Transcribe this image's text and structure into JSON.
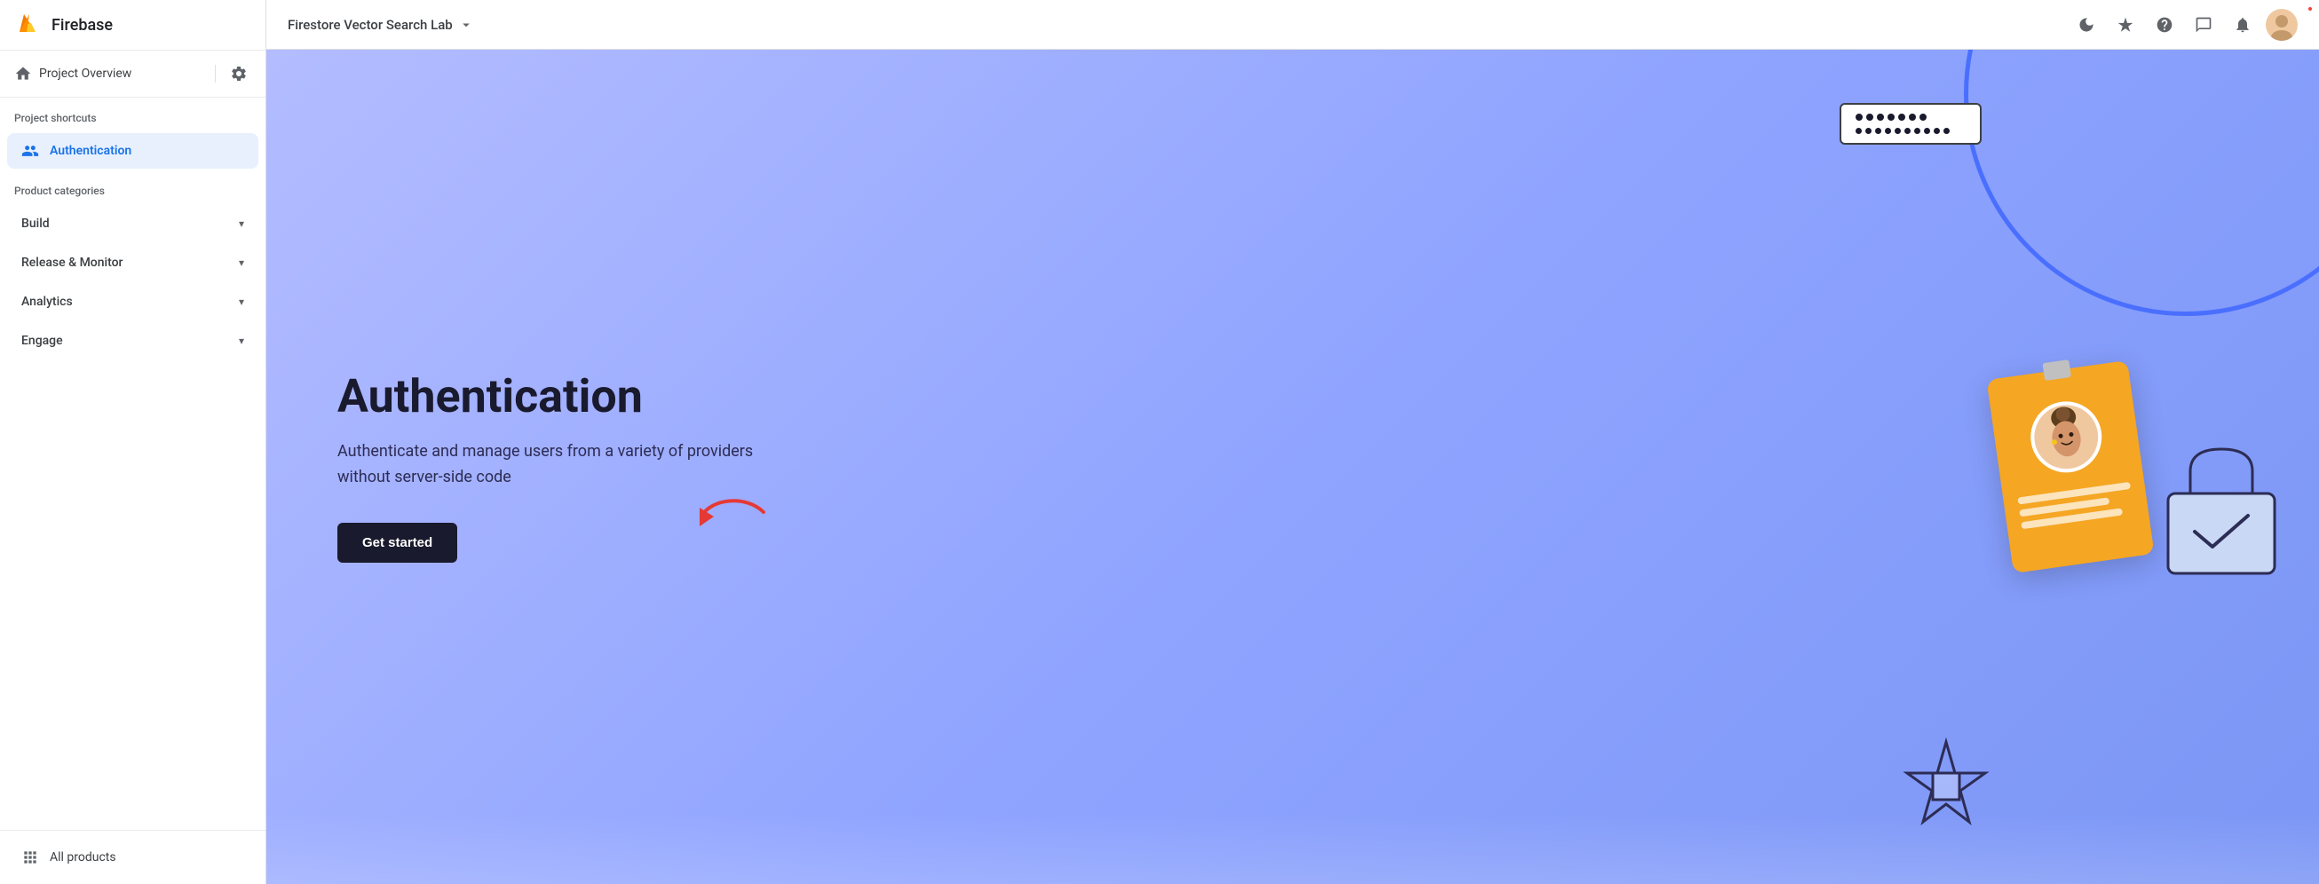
{
  "sidebar": {
    "logo_text": "Firebase",
    "nav_top": {
      "home_label": "Project Overview",
      "home_icon": "home-icon",
      "settings_icon": "settings-icon"
    },
    "project_shortcuts_label": "Project shortcuts",
    "auth_item": {
      "label": "Authentication",
      "icon": "people-icon"
    },
    "product_categories_label": "Product categories",
    "categories": [
      {
        "label": "Build"
      },
      {
        "label": "Release & Monitor"
      },
      {
        "label": "Analytics"
      },
      {
        "label": "Engage"
      }
    ],
    "all_products": {
      "label": "All products",
      "icon": "grid-icon"
    }
  },
  "topbar": {
    "project_name": "Firestore Vector Search Lab",
    "dropdown_icon": "chevron-down-icon",
    "icons": {
      "dark_mode": "moon-icon",
      "sparkle": "sparkle-icon",
      "help": "help-icon",
      "chat": "chat-icon",
      "notifications": "bell-icon",
      "avatar": "user-avatar"
    }
  },
  "hero": {
    "title": "Authentication",
    "description": "Authenticate and manage users from a variety of providers without server-side code",
    "cta_label": "Get started"
  },
  "illustration": {
    "login_dots": [
      "●",
      "●",
      "●",
      "●",
      "●",
      "●",
      "●"
    ],
    "password_dots": [
      "●",
      "●",
      "●",
      "●",
      "●",
      "●",
      "●",
      "●",
      "●",
      "●"
    ]
  }
}
